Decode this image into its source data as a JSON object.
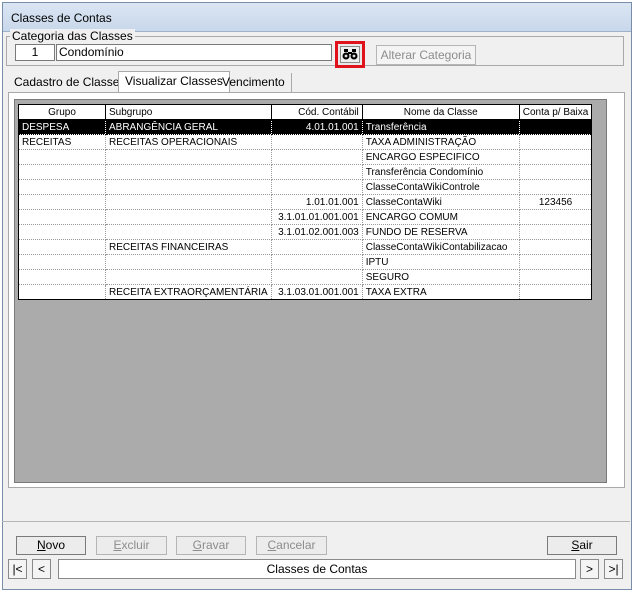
{
  "window": {
    "title": "Classes de Contas"
  },
  "category": {
    "legend": "Categoria das Classes",
    "number": "1",
    "name": "Condomínio",
    "alter_label": "Alterar Categoria"
  },
  "tabs": [
    {
      "label": "Cadastro de Classes"
    },
    {
      "label": "Visualizar Classes"
    },
    {
      "label": "Vencimento"
    }
  ],
  "grid": {
    "columns": [
      "Grupo",
      "Subgrupo",
      "Cód. Contábil",
      "Nome da Classe",
      "Conta p/ Baixa"
    ],
    "rows": [
      [
        "DESPESA",
        "ABRANGÊNCIA GERAL",
        "4.01.01.001",
        "Transferência",
        ""
      ],
      [
        "RECEITAS",
        "RECEITAS OPERACIONAIS",
        "",
        "TAXA ADMINISTRAÇÃO",
        ""
      ],
      [
        "",
        "",
        "",
        "ENCARGO ESPECIFICO",
        ""
      ],
      [
        "",
        "",
        "",
        "Transferência Condomínio",
        ""
      ],
      [
        "",
        "",
        "",
        "ClasseContaWikiControle",
        ""
      ],
      [
        "",
        "",
        "1.01.01.001",
        "ClasseContaWiki",
        "123456"
      ],
      [
        "",
        "",
        "3.1.01.01.001.001",
        "ENCARGO COMUM",
        ""
      ],
      [
        "",
        "",
        "3.1.01.02.001.003",
        "FUNDO DE RESERVA",
        ""
      ],
      [
        "",
        "RECEITAS FINANCEIRAS",
        "",
        "ClasseContaWikiContabilizacao",
        ""
      ],
      [
        "",
        "",
        "",
        "IPTU",
        ""
      ],
      [
        "",
        "",
        "",
        "SEGURO",
        ""
      ],
      [
        "",
        "RECEITA EXTRAORÇAMENTÁRIA",
        "3.1.03.01.001.001",
        "TAXA EXTRA",
        ""
      ]
    ]
  },
  "buttons": {
    "novo": {
      "first": "N",
      "rest": "ovo"
    },
    "excluir": {
      "first": "E",
      "rest": "xcluir"
    },
    "gravar": {
      "first": "G",
      "rest": "ravar"
    },
    "cancelar": {
      "first": "C",
      "rest": "ancelar"
    },
    "sair": {
      "first": "S",
      "rest": "air"
    }
  },
  "navigator": {
    "first": "|<",
    "prev": "<",
    "label": "Classes de Contas",
    "next": ">",
    "last": ">|"
  }
}
